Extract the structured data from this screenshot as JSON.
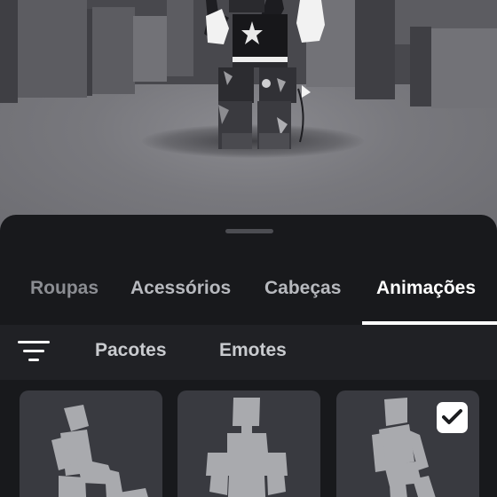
{
  "tabs": [
    {
      "label": "Roupas",
      "state": "inactive"
    },
    {
      "label": "Acessórios",
      "state": "inactive"
    },
    {
      "label": "Cabeças",
      "state": "inactive"
    },
    {
      "label": "Animações",
      "state": "active"
    }
  ],
  "subtabs": [
    {
      "label": "Pacotes"
    },
    {
      "label": "Emotes"
    }
  ],
  "filter_icon": "filter-lines-icon",
  "items": [
    {
      "pose": "sitting-lean",
      "selected": false
    },
    {
      "pose": "standing",
      "selected": false
    },
    {
      "pose": "walking",
      "selected": true
    }
  ],
  "colors": {
    "sheet_bg": "#18191c",
    "subbar_bg": "#202125",
    "card_bg": "#393a40",
    "active_tab": "#ffffff",
    "inactive_tab": "#b7b9be",
    "mannequin": "#a9aaae"
  }
}
